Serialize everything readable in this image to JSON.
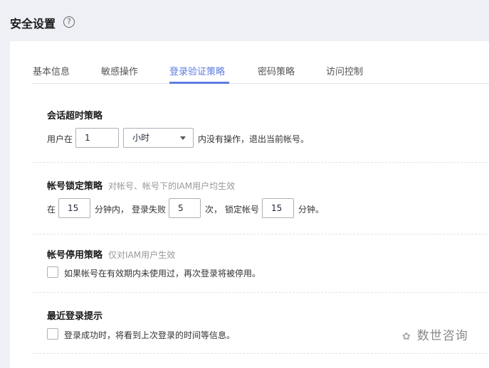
{
  "header": {
    "title": "安全设置",
    "help_icon": "?"
  },
  "tabs": [
    {
      "label": "基本信息"
    },
    {
      "label": "敏感操作"
    },
    {
      "label": "登录验证策略",
      "active": true
    },
    {
      "label": "密码策略"
    },
    {
      "label": "访问控制"
    }
  ],
  "session": {
    "title": "会话超时策略",
    "prefix": "用户在",
    "value": "1",
    "unit": "小时",
    "suffix": "内没有操作，退出当前帐号。"
  },
  "lock": {
    "title": "帐号锁定策略",
    "hint": "对帐号、帐号下的IAM用户均生效",
    "t1": "在",
    "minutes": "15",
    "t2": "分钟内，",
    "t3": "登录失败",
    "attempts": "5",
    "t4": "次，",
    "t5": "锁定帐号",
    "lock_minutes": "15",
    "t6": "分钟。"
  },
  "disable": {
    "title": "帐号停用策略",
    "hint": "仅对IAM用户生效",
    "checkbox_label": "如果帐号在有效期内未使用过，再次登录将被停用。",
    "checked": false
  },
  "recent": {
    "title": "最近登录提示",
    "checkbox_label": "登录成功时，将看到上次登录的时间等信息。",
    "checked": false
  },
  "watermark": "数世咨询"
}
